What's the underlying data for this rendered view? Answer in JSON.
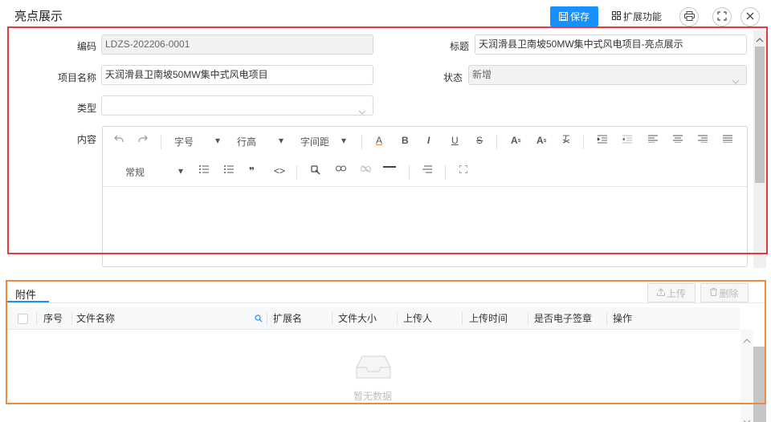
{
  "header": {
    "title": "亮点展示",
    "save_label": "保存",
    "extend_label": "扩展功能"
  },
  "form": {
    "code_label": "编码",
    "code_value": "LDZS-202206-0001",
    "title_label": "标题",
    "title_value": "天润滑县卫南坡50MW集中式风电项目-亮点展示",
    "project_label": "项目名称",
    "project_value": "天润滑县卫南坡50MW集中式风电项目",
    "status_label": "状态",
    "status_value": "新增",
    "type_label": "类型",
    "type_value": "",
    "content_label": "内容"
  },
  "editor": {
    "font_size_label": "字号",
    "line_height_label": "行高",
    "letter_spacing_label": "字间距",
    "paragraph_label": "常规",
    "color_text_glyph": "A",
    "bold_glyph": "B",
    "italic_glyph": "I",
    "underline_glyph": "U",
    "strike_glyph": "S",
    "superscript_glyph": "A",
    "subscript_glyph": "A",
    "quote_glyph": "❞",
    "code_glyph": "<>"
  },
  "attachments": {
    "tab_label": "附件",
    "upload_label": "上传",
    "delete_label": "删除",
    "columns": [
      "序号",
      "文件名称",
      "扩展名",
      "文件大小",
      "上传人",
      "上传时间",
      "是否电子签章",
      "操作"
    ],
    "empty_text": "暂无数据"
  },
  "colors": {
    "primary": "#1890ff",
    "highlight_red": "#e8383d",
    "highlight_orange": "#f0883e"
  }
}
